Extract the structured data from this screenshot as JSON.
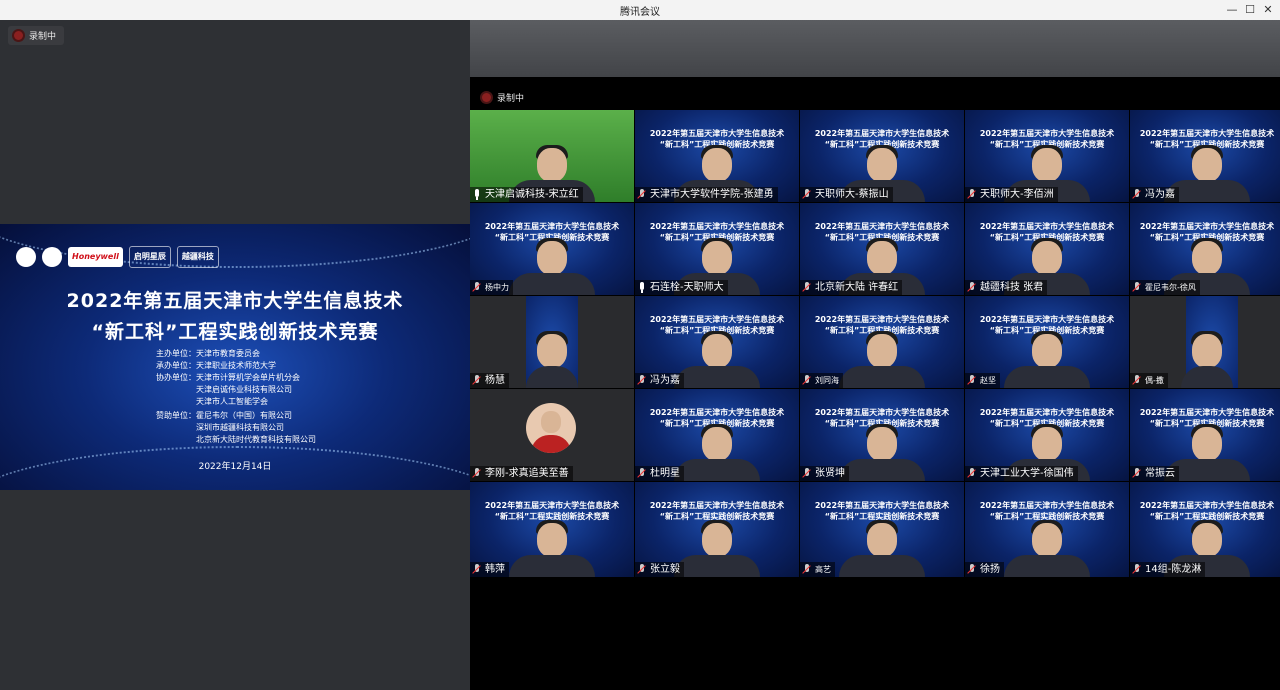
{
  "window": {
    "title": "腾讯会议"
  },
  "recording": {
    "label": "录制中"
  },
  "slide": {
    "title_line1": "2022年第五届天津市大学生信息技术",
    "title_line2": "“新工科”工程实践创新技术竞赛",
    "logos": [
      "Honeywell",
      "启明星辰",
      "越疆科技"
    ],
    "organizers": [
      "主办单位：天津市教育委员会",
      "承办单位：天津职业技术师范大学",
      "协办单位：天津市计算机学会单片机分会",
      "　　　　　天津启诚伟业科技有限公司",
      "　　　　　天津市人工智能学会",
      "赞助单位：霍尼韦尔（中国）有限公司",
      "　　　　　深圳市越疆科技有限公司",
      "　　　　　北京新大陆时代教育科技有限公司"
    ],
    "date": "2022年12月14日"
  },
  "tile_banner": {
    "line1": "2022年第五届天津市大学生信息技术",
    "line2": "“新工科”工程实践创新技术竞赛"
  },
  "participants": [
    {
      "name": "天津启诚科技-宋立红",
      "style": "green",
      "mic": "on"
    },
    {
      "name": "天津市大学软件学院-张建勇",
      "style": "blue",
      "mic": "off"
    },
    {
      "name": "天职师大-蔡振山",
      "style": "blue",
      "mic": "off"
    },
    {
      "name": "天职师大-李佰洲",
      "style": "blue",
      "mic": "off"
    },
    {
      "name": "冯为嘉",
      "style": "blue",
      "mic": "off"
    },
    {
      "name": "杨中力",
      "style": "blue",
      "mic": "off",
      "small": true
    },
    {
      "name": "石连栓-天职师大",
      "style": "blue",
      "mic": "on"
    },
    {
      "name": "北京新大陆 许春红",
      "style": "blue",
      "mic": "off"
    },
    {
      "name": "越疆科技 张君",
      "style": "blue",
      "mic": "off"
    },
    {
      "name": "霍尼韦尔-徐风",
      "style": "blue",
      "mic": "off",
      "small": true
    },
    {
      "name": "杨慧",
      "style": "dark-blue",
      "mic": "off"
    },
    {
      "name": "冯为嘉",
      "style": "blue",
      "mic": "off"
    },
    {
      "name": "刘同海",
      "style": "blue",
      "mic": "off",
      "small": true
    },
    {
      "name": "赵坚",
      "style": "blue",
      "mic": "off",
      "small": true
    },
    {
      "name": "偶-撒",
      "style": "dark-blue",
      "mic": "off",
      "small": true
    },
    {
      "name": "李刚-求真追美至善",
      "style": "dark-avatar",
      "mic": "off"
    },
    {
      "name": "杜明星",
      "style": "blue",
      "mic": "off"
    },
    {
      "name": "张贤坤",
      "style": "blue",
      "mic": "off"
    },
    {
      "name": "天津工业大学-徐国伟",
      "style": "blue",
      "mic": "off"
    },
    {
      "name": "常振云",
      "style": "blue",
      "mic": "off"
    },
    {
      "name": "韩萍",
      "style": "blue",
      "mic": "off"
    },
    {
      "name": "张立毅",
      "style": "blue",
      "mic": "off"
    },
    {
      "name": "高艺",
      "style": "blue",
      "mic": "off",
      "small": true
    },
    {
      "name": "徐扬",
      "style": "blue",
      "mic": "off"
    },
    {
      "name": "14组-陈龙淋",
      "style": "blue",
      "mic": "off"
    }
  ]
}
